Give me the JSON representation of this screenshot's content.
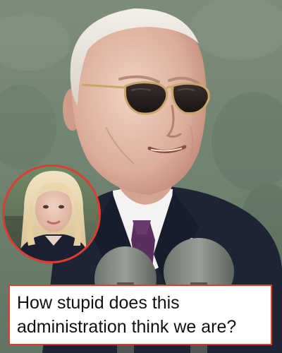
{
  "caption": {
    "text": "How stupid does this administration think we are?"
  },
  "colors": {
    "accent_border": "#e23b2e",
    "caption_text": "#111111",
    "caption_bg": "#ffffff"
  },
  "scene": {
    "main_subject": "older-man-in-aviator-sunglasses-at-microphones-photo",
    "inset_subject": "blonde-woman-in-dark-jacket-photo"
  }
}
